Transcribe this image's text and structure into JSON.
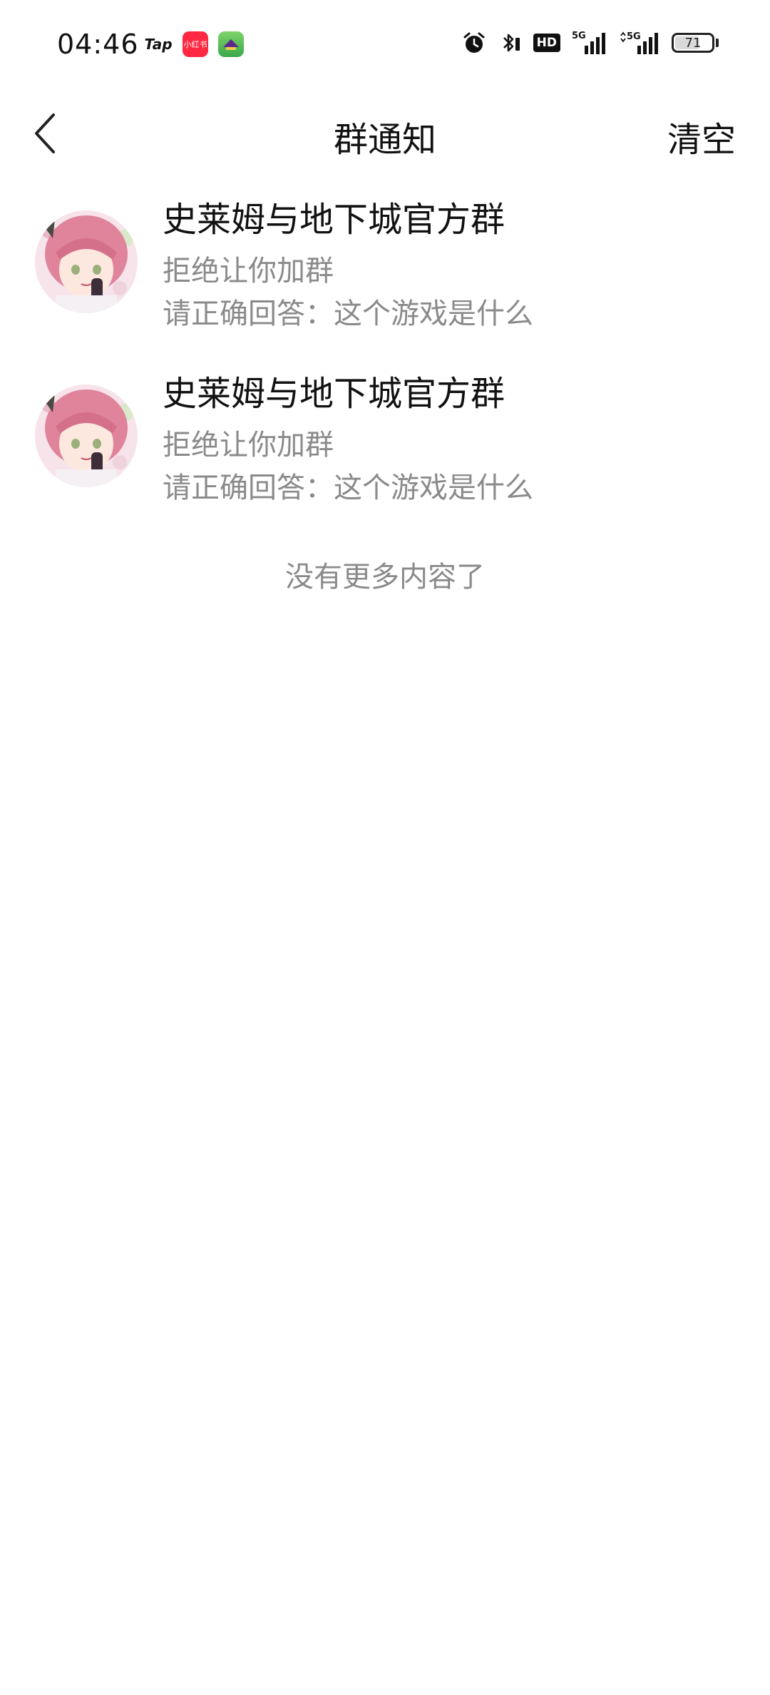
{
  "status_bar": {
    "time": "04:46",
    "app_icons": [
      {
        "name": "tap-icon",
        "label": "Tap"
      },
      {
        "name": "xiaohongshu-icon",
        "label": "小红书"
      },
      {
        "name": "game-app-icon",
        "label": ""
      }
    ],
    "signal_1": "5G",
    "signal_2": "5G",
    "hd_label": "HD",
    "battery_level": "71",
    "battery_fraction": 0.71
  },
  "nav": {
    "title": "群通知",
    "clear_label": "清空"
  },
  "notifications": [
    {
      "group_name": "史莱姆与地下城官方群",
      "status": "拒绝让你加群",
      "question": "请正确回答：这个游戏是什么"
    },
    {
      "group_name": "史莱姆与地下城官方群",
      "status": "拒绝让你加群",
      "question": "请正确回答：这个游戏是什么"
    }
  ],
  "footer": {
    "no_more": "没有更多内容了"
  },
  "colors": {
    "primary_text": "#111111",
    "secondary_text": "#8a8a8a",
    "background": "#ffffff"
  }
}
